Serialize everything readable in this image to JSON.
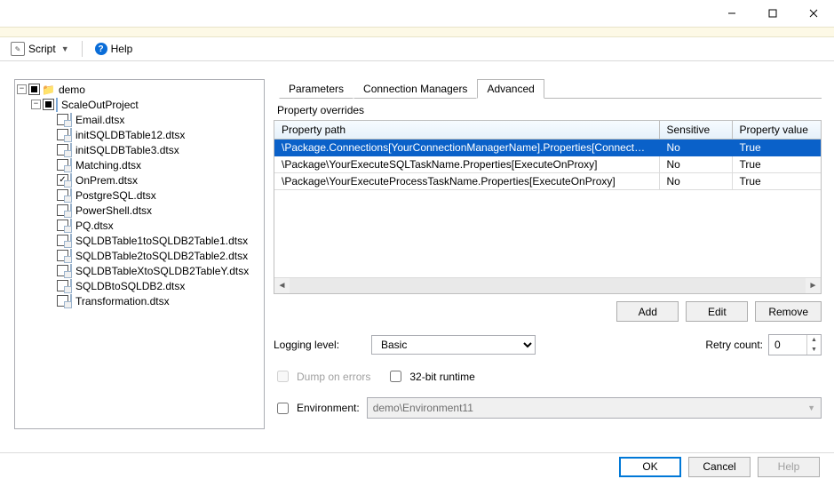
{
  "toolbar": {
    "script_label": "Script",
    "help_label": "Help"
  },
  "tree": {
    "root": "demo",
    "project": "ScaleOutProject",
    "packages": [
      {
        "label": "Email.dtsx",
        "checked": "off"
      },
      {
        "label": "initSQLDBTable12.dtsx",
        "checked": "off"
      },
      {
        "label": "initSQLDBTable3.dtsx",
        "checked": "off"
      },
      {
        "label": "Matching.dtsx",
        "checked": "off"
      },
      {
        "label": "OnPrem.dtsx",
        "checked": "on"
      },
      {
        "label": "PostgreSQL.dtsx",
        "checked": "off"
      },
      {
        "label": "PowerShell.dtsx",
        "checked": "off"
      },
      {
        "label": "PQ.dtsx",
        "checked": "off"
      },
      {
        "label": "SQLDBTable1toSQLDB2Table1.dtsx",
        "checked": "off"
      },
      {
        "label": "SQLDBTable2toSQLDB2Table2.dtsx",
        "checked": "off"
      },
      {
        "label": "SQLDBTableXtoSQLDB2TableY.dtsx",
        "checked": "off"
      },
      {
        "label": "SQLDBtoSQLDB2.dtsx",
        "checked": "off"
      },
      {
        "label": "Transformation.dtsx",
        "checked": "off"
      }
    ]
  },
  "tabs": {
    "items": [
      "Parameters",
      "Connection Managers",
      "Advanced"
    ],
    "active": 2
  },
  "overrides": {
    "section_label": "Property overrides",
    "columns": [
      "Property path",
      "Sensitive",
      "Property value"
    ],
    "rows": [
      {
        "path": "\\Package.Connections[YourConnectionManagerName].Properties[ConnectByProxy]",
        "sensitive": "No",
        "value": "True",
        "selected": true
      },
      {
        "path": "\\Package\\YourExecuteSQLTaskName.Properties[ExecuteOnProxy]",
        "sensitive": "No",
        "value": "True",
        "selected": false
      },
      {
        "path": "\\Package\\YourExecuteProcessTaskName.Properties[ExecuteOnProxy]",
        "sensitive": "No",
        "value": "True",
        "selected": false
      }
    ],
    "buttons": {
      "add": "Add",
      "edit": "Edit",
      "remove": "Remove"
    }
  },
  "options": {
    "logging_label": "Logging level:",
    "logging_value": "Basic",
    "retry_label": "Retry count:",
    "retry_value": "0",
    "dump_label": "Dump on errors",
    "runtime32_label": "32-bit runtime",
    "env_label": "Environment:",
    "env_value": "demo\\Environment11"
  },
  "footer": {
    "ok": "OK",
    "cancel": "Cancel",
    "help": "Help"
  }
}
